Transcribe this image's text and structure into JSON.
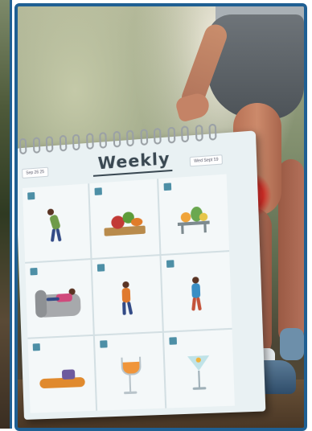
{
  "calendar": {
    "title": "Weekly",
    "tag_left": "Sep 26 25",
    "tag_right": "Wed Sept 19",
    "cells": [
      {
        "name": "stretching-figure"
      },
      {
        "name": "vegetable-platter"
      },
      {
        "name": "fruit-table"
      },
      {
        "name": "resting-in-armchair"
      },
      {
        "name": "drinking-water-figure"
      },
      {
        "name": "walking-figure"
      },
      {
        "name": "cushion-rest"
      },
      {
        "name": "orange-drink-glass"
      },
      {
        "name": "cocktail-glass"
      }
    ]
  },
  "colors": {
    "frame_border": "#1f5f93",
    "knee_glow": "#ff3333",
    "checkbox": "#4d8fa6",
    "calendar_bg": "#e9f1f3"
  }
}
